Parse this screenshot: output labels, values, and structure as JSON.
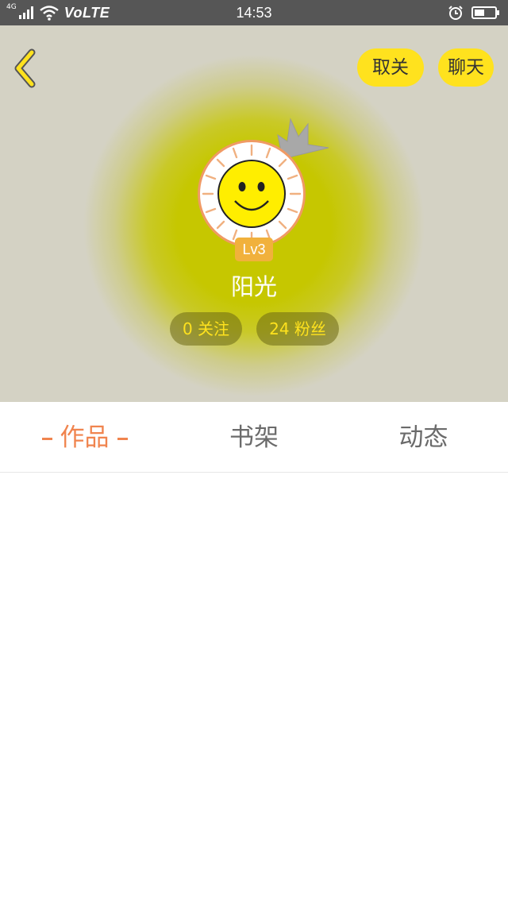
{
  "status_bar": {
    "network": "4G",
    "carrier_tech": "VoLTE",
    "time": "14:53",
    "icons": [
      "signal-icon",
      "wifi-icon",
      "alarm-icon",
      "battery-icon"
    ]
  },
  "header": {
    "back_icon": "chevron-left-icon",
    "unfollow_label": "取关",
    "chat_label": "聊天",
    "accent_color": "#ffe21e"
  },
  "profile": {
    "level": "Lv3",
    "username": "阳光",
    "following": "0 关注",
    "fans": "24 粉丝"
  },
  "tabs": [
    {
      "label": "作品",
      "active": true
    },
    {
      "label": "书架",
      "active": false
    },
    {
      "label": "动态",
      "active": false
    }
  ],
  "colors": {
    "active_tab": "#f0844e",
    "inactive_tab": "#6b6b6b",
    "badge": "#f1b13c"
  }
}
